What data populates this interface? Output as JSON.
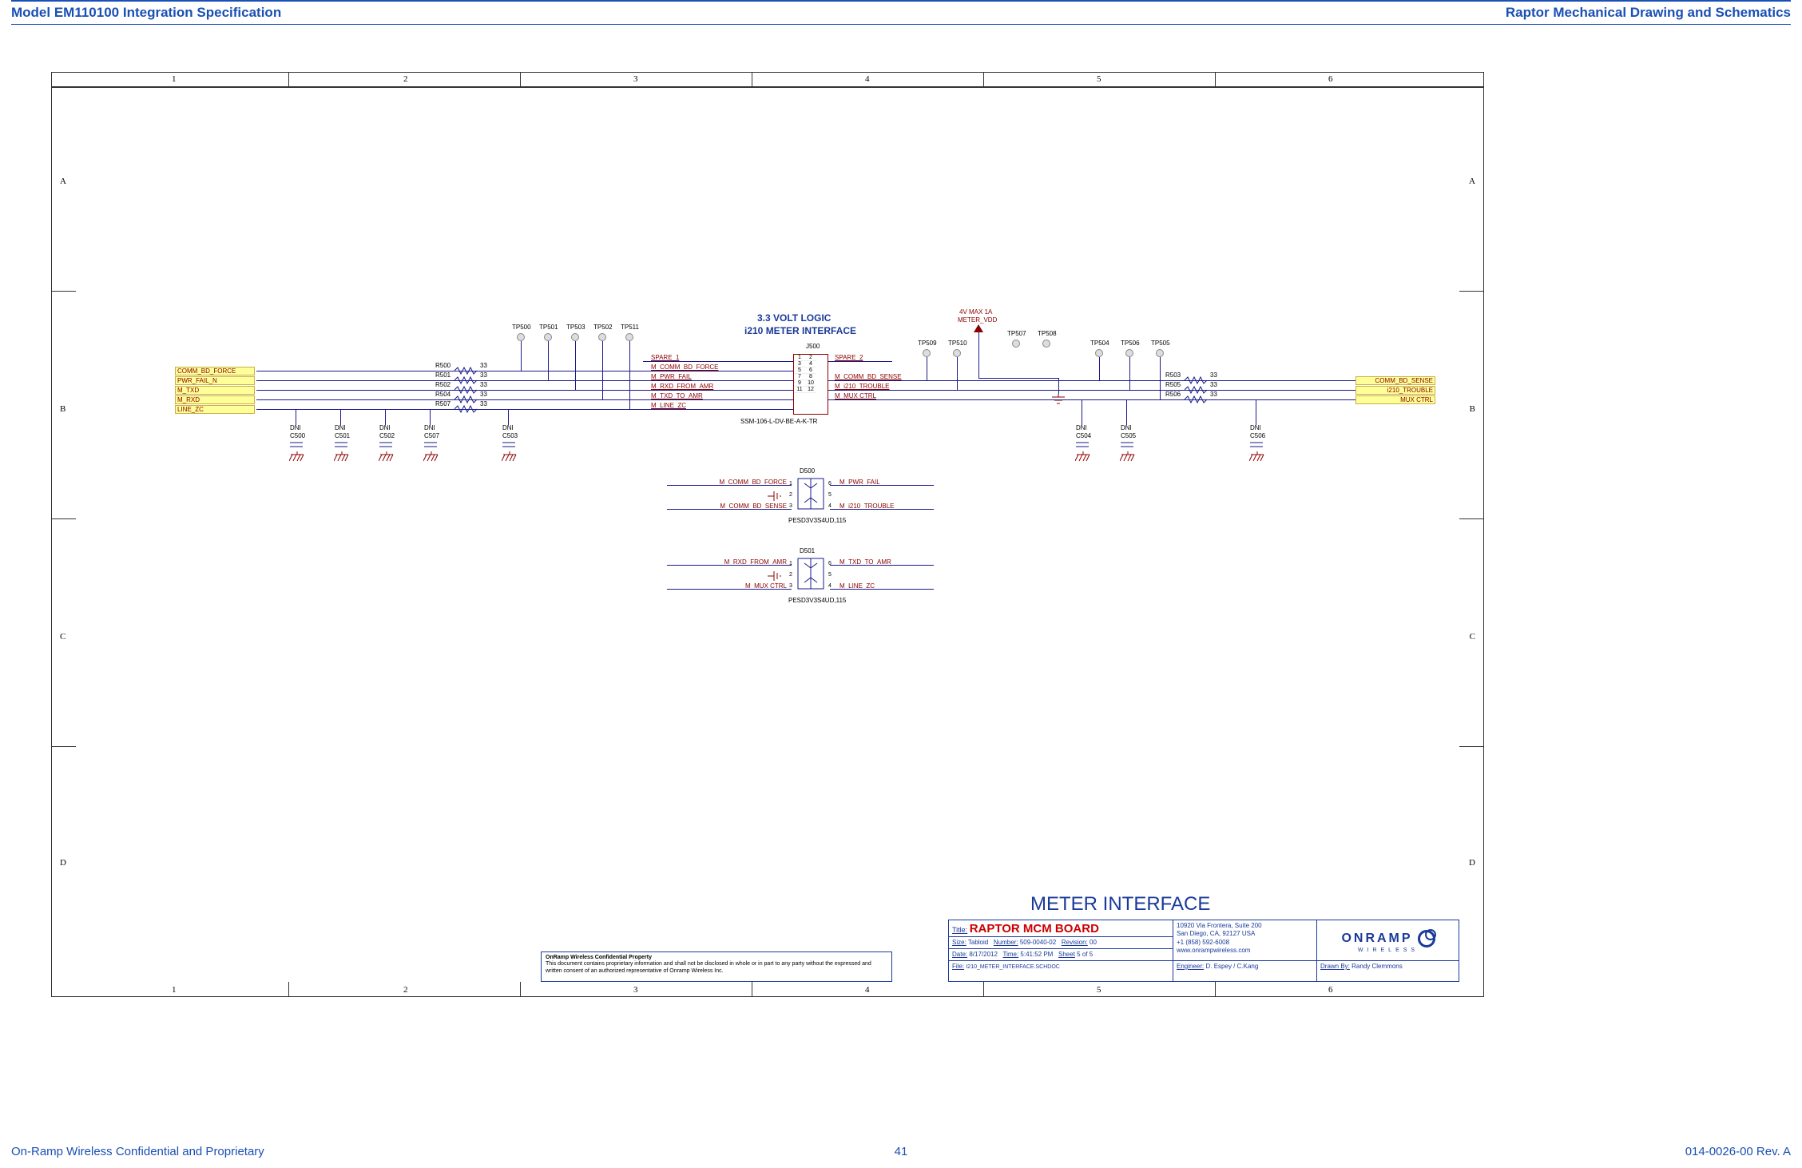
{
  "header": {
    "left": "Model EM110100 Integration Specification",
    "right": "Raptor Mechanical Drawing and Schematics"
  },
  "footer": {
    "left": "On-Ramp Wireless Confidential and Proprietary",
    "center": "41",
    "right": "014-0026-00 Rev. A"
  },
  "border": {
    "cols": [
      "1",
      "2",
      "3",
      "4",
      "5",
      "6"
    ],
    "rows": [
      "A",
      "B",
      "C",
      "D"
    ]
  },
  "section_title": "METER INTERFACE",
  "logic_title": "3.3 VOLT LOGIC",
  "interface_title": "i210 METER INTERFACE",
  "meter_vdd": {
    "label": "METER_VDD",
    "rating": "4V MAX 1A"
  },
  "connector": {
    "ref": "J500",
    "part": "SSM-106-L-DV-BE-A-K-TR",
    "pins_left": [
      "1",
      "3",
      "5",
      "7",
      "9",
      "11"
    ],
    "pins_right": [
      "2",
      "4",
      "6",
      "8",
      "10",
      "12"
    ]
  },
  "left_ports": [
    "COMM_BD_FORCE",
    "PWR_FAIL_N",
    "M_TXD",
    "M_RXD",
    "LINE_ZC"
  ],
  "right_ports": [
    "COMM_BD_SENSE",
    "i210_TROUBLE",
    "MUX CTRL"
  ],
  "series_res_left": [
    {
      "ref": "R500",
      "val": "33"
    },
    {
      "ref": "R501",
      "val": "33"
    },
    {
      "ref": "R502",
      "val": "33"
    },
    {
      "ref": "R504",
      "val": "33"
    },
    {
      "ref": "R507",
      "val": "33"
    }
  ],
  "series_res_right": [
    {
      "ref": "R503",
      "val": "33"
    },
    {
      "ref": "R505",
      "val": "33"
    },
    {
      "ref": "R506",
      "val": "33"
    }
  ],
  "net_left": [
    "SPARE_1",
    "M_COMM_BD_FORCE",
    "M_PWR_FAIL",
    "M_RXD_FROM_AMR",
    "M_TXD_TO_AMR",
    "M_LINE_ZC"
  ],
  "net_right": [
    "SPARE_2",
    "",
    "",
    "M_COMM_BD_SENSE",
    "M_i210_TROUBLE",
    "M_MUX CTRL"
  ],
  "testpoints_left": [
    "TP500",
    "TP501",
    "TP503",
    "TP502",
    "TP511"
  ],
  "testpoints_mid": [
    "TP509",
    "TP510"
  ],
  "testpoints_vdd": [
    "TP507",
    "TP508"
  ],
  "testpoints_right": [
    "TP504",
    "TP506",
    "TP505"
  ],
  "dni_caps_left": [
    {
      "ref": "C500"
    },
    {
      "ref": "C501"
    },
    {
      "ref": "C502"
    },
    {
      "ref": "C507"
    },
    {
      "ref": "C503"
    }
  ],
  "dni_caps_right": [
    {
      "ref": "C504"
    },
    {
      "ref": "C505"
    },
    {
      "ref": "C506"
    }
  ],
  "dni_label": "DNI",
  "tvs": [
    {
      "ref": "D500",
      "part": "PESD3V3S4UD,115",
      "left": [
        "M_COMM_BD_FORCE",
        "M_COMM_BD_SENSE"
      ],
      "right": [
        "M_PWR_FAIL",
        "M_i210_TROUBLE"
      ]
    },
    {
      "ref": "D501",
      "part": "PESD3V3S4UD,115",
      "left": [
        "M_RXD_FROM_AMR",
        "M_MUX CTRL"
      ],
      "right": [
        "M_TXD_TO_AMR",
        "M_LINE_ZC"
      ]
    }
  ],
  "titleblock": {
    "title_label": "Title:",
    "title": "RAPTOR MCM BOARD",
    "size_label": "Size:",
    "size": "Tabloid",
    "number_label": "Number:",
    "number": "509-0040-02",
    "rev_label": "Revision:",
    "rev": "00",
    "date_label": "Date:",
    "date": "8/17/2012",
    "time_label": "Time:",
    "time": "5:41:52 PM",
    "sheet_label": "Sheet",
    "sheet": "5",
    "sheet_of": "of",
    "sheet_total": "5",
    "file_label": "File:",
    "file": "I210_METER_INTERFACE.SCHDOC",
    "engineer_label": "Engineer:",
    "engineer": "D. Espey / C.Kang",
    "drawn_label": "Drawn By:",
    "drawn": "Randy Clemmons",
    "addr1": "10920 Via Frontera, Suite 200",
    "addr2": "San Diego, CA, 92127 USA",
    "addr3": "+1 (858) 592-6008",
    "addr4": "www.onrampwireless.com",
    "logo_main": "ONRAMP",
    "logo_sub": "WIRELESS"
  },
  "proprietary": {
    "heading": "OnRamp Wireless Confidential Property",
    "body": "This document contains proprietary information and shall not be disclosed in whole or in part to any party without the expressed and written consent of an authorized representative of Onramp Wireless Inc."
  }
}
